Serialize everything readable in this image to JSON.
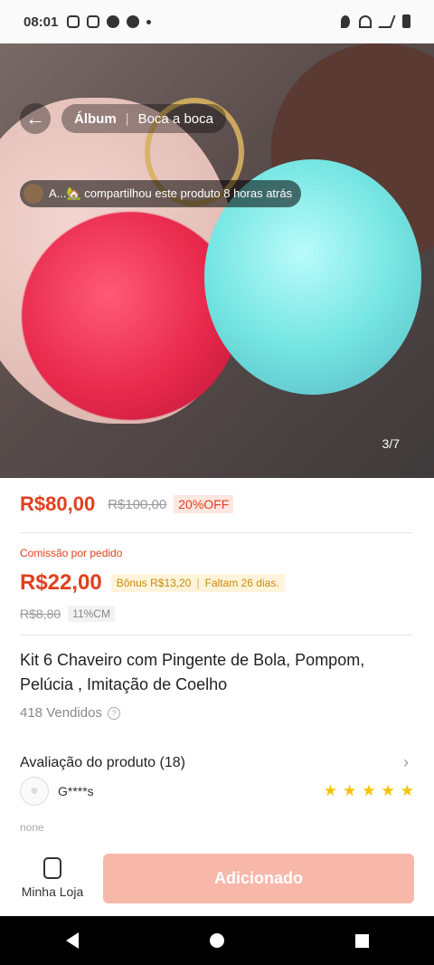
{
  "status": {
    "time": "08:01"
  },
  "header": {
    "tab_album": "Álbum",
    "tab_word": "Boca a boca"
  },
  "share_notice": "A...🏡 compartilhou este produto 8 horas atrás",
  "gallery": {
    "counter": "3/7"
  },
  "pricing": {
    "price": "R$80,00",
    "original_price": "R$100,00",
    "discount": "20%OFF"
  },
  "commission": {
    "label": "Comissão por pedido",
    "price": "R$22,00",
    "bonus": "Bônus R$13,20",
    "remaining": "Faltam 26 dias.",
    "original": "R$8,80",
    "rate": "11%CM"
  },
  "product": {
    "title": "Kit 6 Chaveiro com Pingente de Bola, Pompom, Pelúcia , Imitação de Coelho",
    "sold": "418 Vendidos"
  },
  "reviews": {
    "title": "Avaliação do produto (18)",
    "reviewer": "G****s",
    "rating": 5,
    "text": "none"
  },
  "bottom": {
    "shop_label": "Minha Loja",
    "add_button": "Adicionado"
  },
  "colors": {
    "accent": "#e0401f",
    "button_disabled": "#f7b8aa",
    "star": "#f5c400"
  }
}
